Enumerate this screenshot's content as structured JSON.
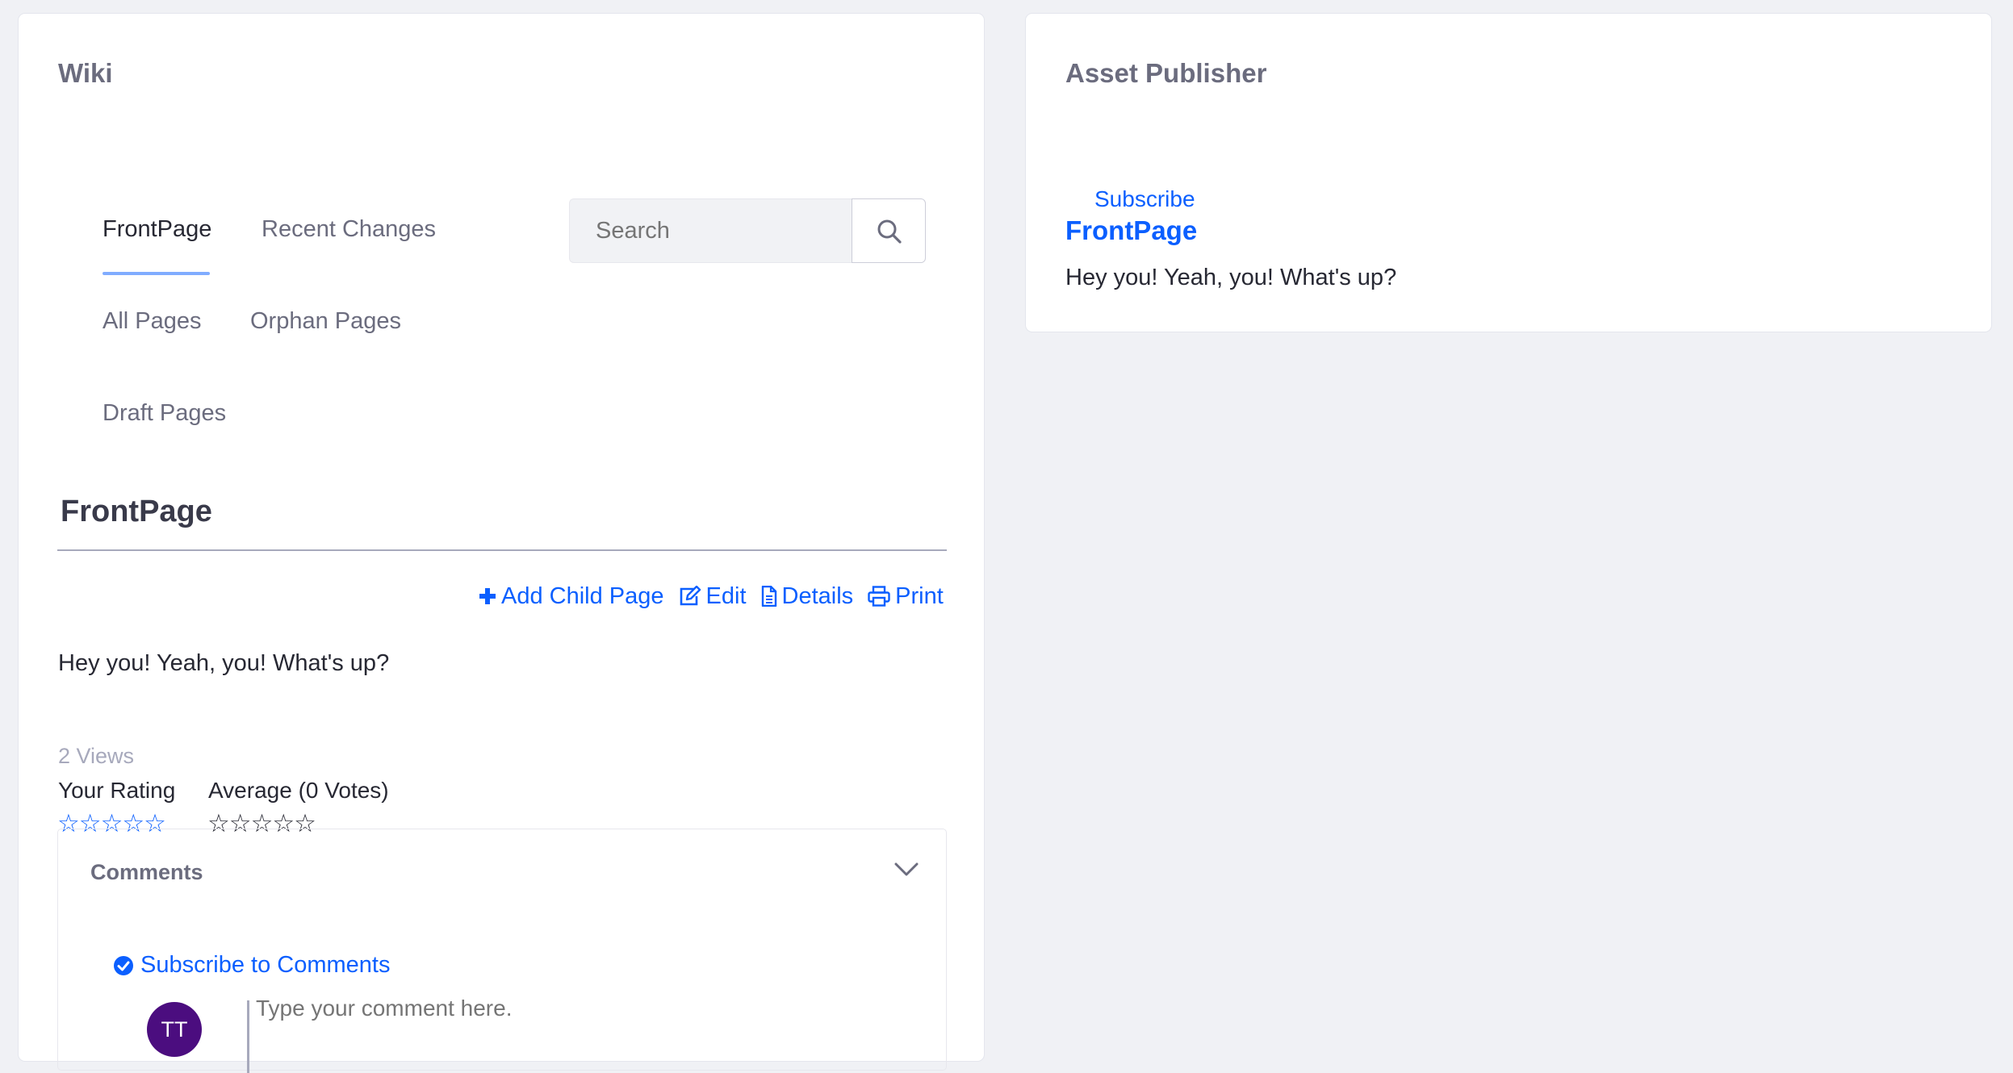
{
  "wiki": {
    "portlet_title": "Wiki",
    "nav": {
      "front_page": "FrontPage",
      "recent_changes": "Recent Changes",
      "all_pages": "All Pages",
      "orphan_pages": "Orphan Pages",
      "draft_pages": "Draft Pages"
    },
    "search": {
      "placeholder": "Search",
      "icon": "search-icon"
    },
    "page_title": "FrontPage",
    "actions": {
      "add_child": "Add Child Page",
      "edit": "Edit",
      "details": "Details",
      "print": "Print"
    },
    "content": "Hey you! Yeah, you! What's up?",
    "views": "2 Views",
    "rating": {
      "your_rating_label": "Your Rating",
      "your_rating_stars": "☆☆☆☆☆",
      "your_rating_value": 0,
      "average_label": "Average (0 Votes)",
      "average_stars": "☆☆☆☆☆",
      "average_value": 0
    },
    "comments": {
      "title": "Comments",
      "subscribe": "Subscribe to Comments",
      "avatar_initials": "TT",
      "placeholder": "Type your comment here."
    }
  },
  "asset_publisher": {
    "portlet_title": "Asset Publisher",
    "subscribe": "Subscribe",
    "entry_title": "FrontPage",
    "entry_summary": "Hey you! Yeah, you! What's up?"
  },
  "colors": {
    "accent": "#0b5fff",
    "background": "#f0f1f5",
    "avatar": "#4b0d7f",
    "nav_underline": "#80acff"
  }
}
